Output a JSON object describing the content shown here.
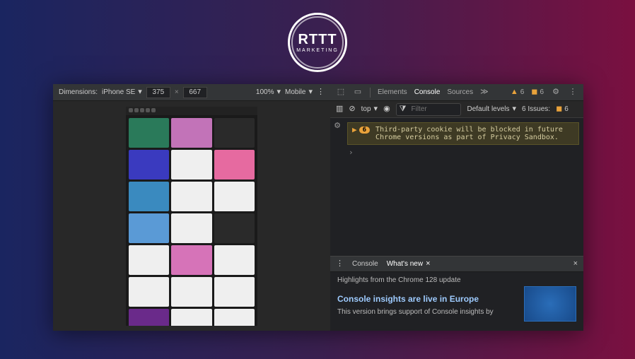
{
  "logo": {
    "main": "RTTT",
    "sub": "MARKETING"
  },
  "deviceToolbar": {
    "dimensionsLabel": "Dimensions:",
    "deviceName": "iPhone SE",
    "width": "375",
    "separator": "×",
    "height": "667",
    "zoom": "100%",
    "throttle": "Mobile"
  },
  "mainTabs": {
    "elements": "Elements",
    "console": "Console",
    "sources": "Sources",
    "more": "≫",
    "warningsCount": "6",
    "issuesIndicatorCount": "6"
  },
  "consoleToolbar": {
    "context": "top",
    "filterPlaceholder": "Filter",
    "levels": "Default levels",
    "issuesLabel": "6 Issues:",
    "issuesCount": "6"
  },
  "consoleWarning": {
    "count": "6",
    "message": "Third-party cookie will be blocked in future Chrome versions as part of Privacy Sandbox."
  },
  "consolePrompt": "›",
  "drawer": {
    "tabConsole": "Console",
    "tabWhatsNew": "What's new",
    "highlight": "Highlights from the Chrome 128 update",
    "insightTitle": "Console insights are live in Europe",
    "insightBody": "This version brings support of Console insights by"
  },
  "thumbnails": [
    "#2a7a5a",
    "#c273b8",
    "#2a2a2a",
    "#3a3abf",
    "#efefef",
    "#e66aa0",
    "#3a8abf",
    "#efefef",
    "#efefef",
    "#5a9ad6",
    "#efefef",
    "#2a2a2a",
    "#efefef",
    "#d673b8",
    "#efefef",
    "#efefef",
    "#efefef",
    "#efefef",
    "#6a2a8a",
    "#efefef",
    "#efefef"
  ]
}
